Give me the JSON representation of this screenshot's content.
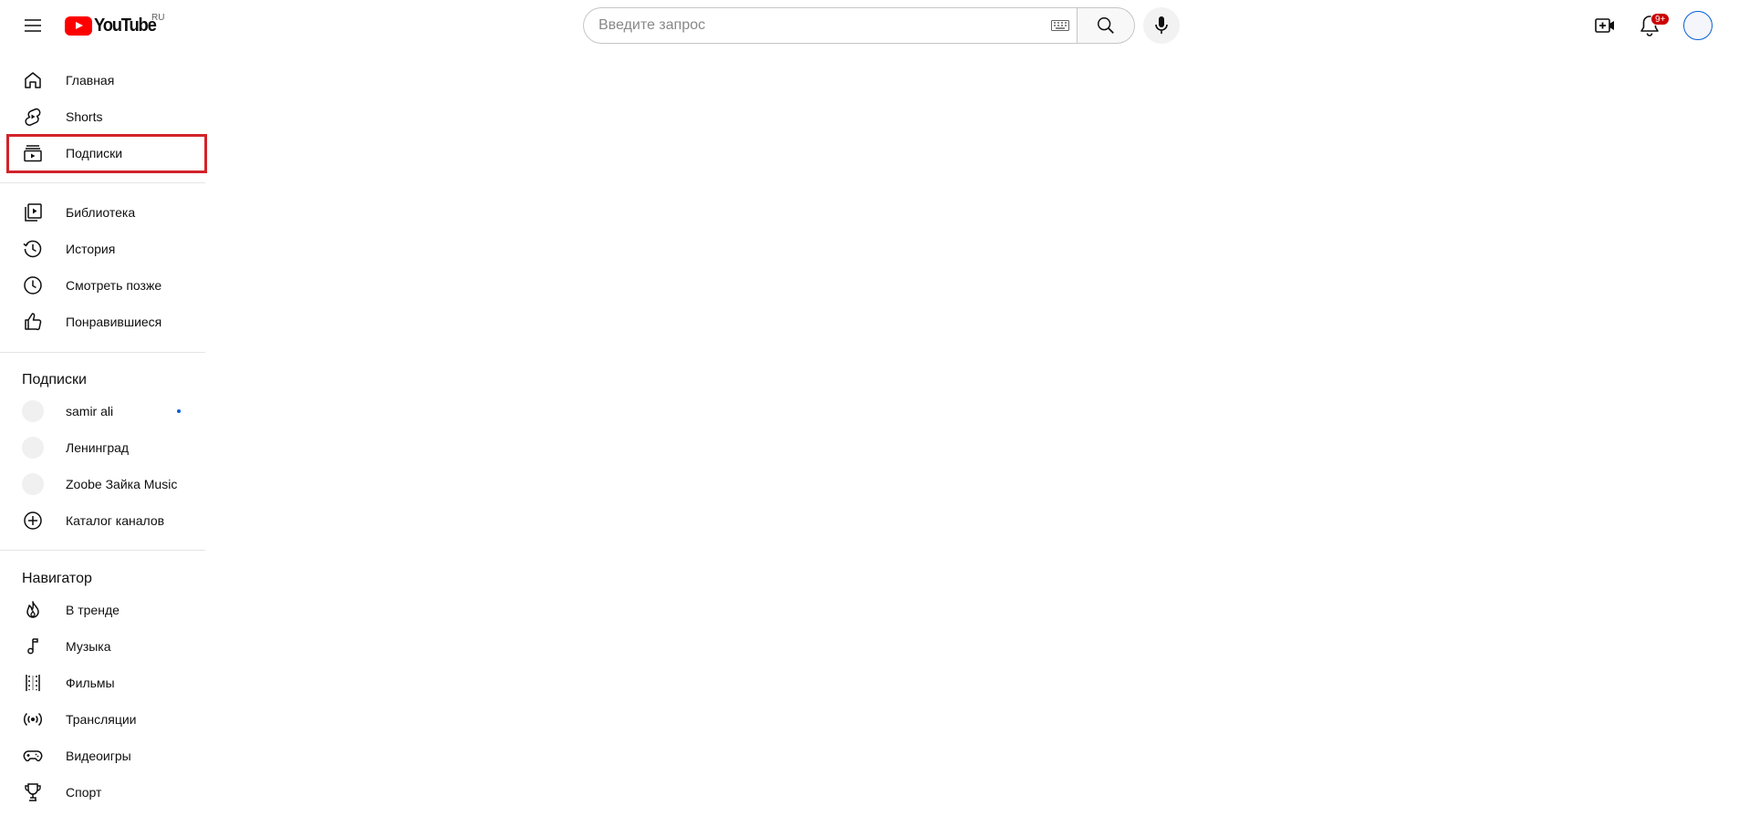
{
  "header": {
    "logo_text": "YouTube",
    "region": "RU",
    "search_placeholder": "Введите запрос",
    "notifications_badge": "9+"
  },
  "sidebar": {
    "main": [
      {
        "label": "Главная",
        "icon": "home-icon"
      },
      {
        "label": "Shorts",
        "icon": "shorts-icon"
      },
      {
        "label": "Подписки",
        "icon": "subscriptions-icon"
      }
    ],
    "you": [
      {
        "label": "Библиотека",
        "icon": "library-icon"
      },
      {
        "label": "История",
        "icon": "history-icon"
      },
      {
        "label": "Смотреть позже",
        "icon": "watch-later-icon"
      },
      {
        "label": "Понравившиеся",
        "icon": "like-icon"
      }
    ],
    "subscriptions_title": "Подписки",
    "subscriptions": [
      {
        "label": "samir ali",
        "has_new": true
      },
      {
        "label": "Ленинград",
        "has_new": false
      },
      {
        "label": "Zoobe Зайка Music",
        "has_new": false
      }
    ],
    "catalog_label": "Каталог каналов",
    "explore_title": "Навигатор",
    "explore": [
      {
        "label": "В тренде",
        "icon": "trending-icon"
      },
      {
        "label": "Музыка",
        "icon": "music-icon"
      },
      {
        "label": "Фильмы",
        "icon": "movies-icon"
      },
      {
        "label": "Трансляции",
        "icon": "live-icon"
      },
      {
        "label": "Видеоигры",
        "icon": "gaming-icon"
      },
      {
        "label": "Спорт",
        "icon": "sports-icon"
      }
    ]
  },
  "colors": {
    "brand_red": "#ff0000",
    "highlight_red": "#d2232a",
    "accent_blue": "#065fd4"
  }
}
